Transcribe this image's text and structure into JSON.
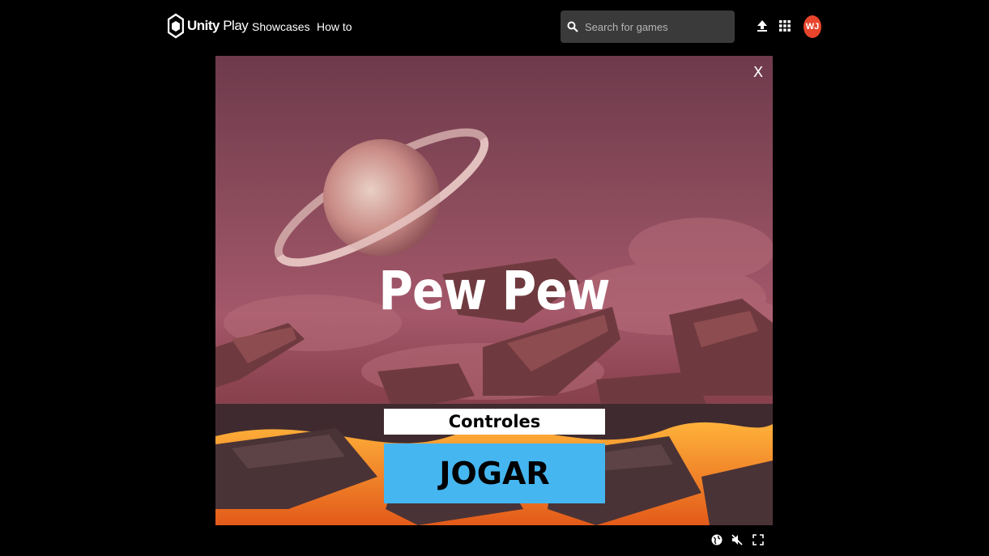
{
  "nav": {
    "logo_strong": "Unity",
    "logo_rest": " Play",
    "links": [
      "Showcases",
      "How to"
    ],
    "search_placeholder": "Search for games",
    "avatar_initials": "WJ",
    "icons": [
      "upload-icon",
      "apps-grid-icon"
    ]
  },
  "game": {
    "title": "Pew Pew",
    "close_label": "X",
    "controles_label": "Controles",
    "play_label": "JOGAR",
    "play_color": "#45b6f0"
  },
  "player_controls": {
    "icons": [
      "globe-icon",
      "mute-icon",
      "fullscreen-icon"
    ]
  },
  "colors": {
    "avatar": "#e8452c",
    "search_bg": "#3a3a3a"
  }
}
